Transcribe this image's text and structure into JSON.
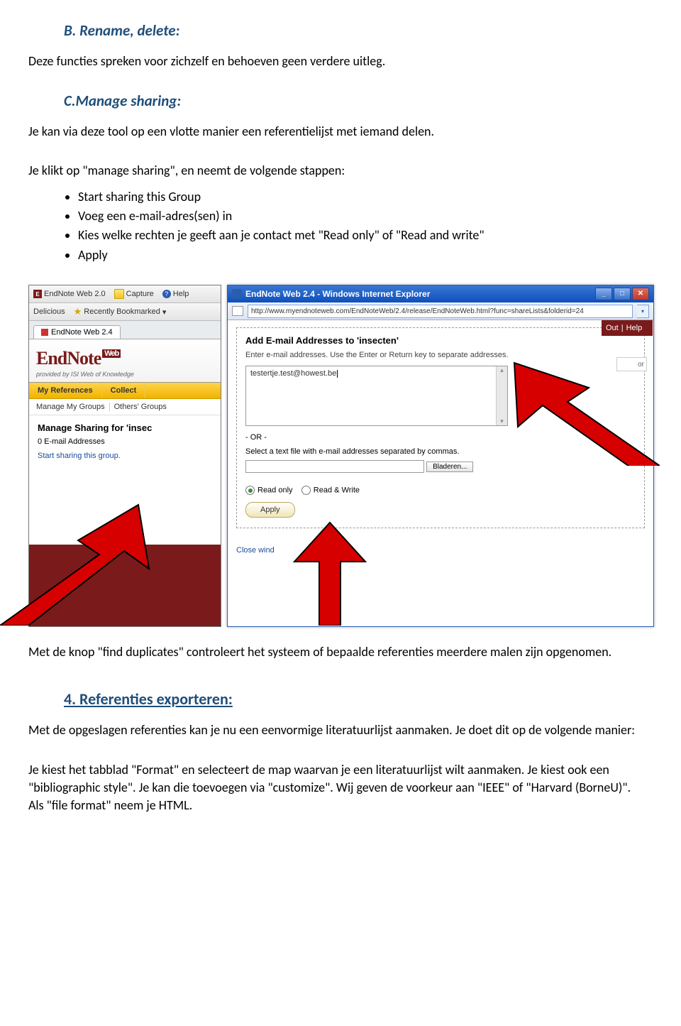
{
  "sectionB": {
    "title": "B. Rename, delete:",
    "body": "Deze functies spreken voor zichzelf en behoeven geen verdere uitleg."
  },
  "sectionC": {
    "title": "C.Manage sharing:",
    "intro": "Je kan via deze tool op een vlotte manier een referentielijst met iemand delen.",
    "intro2": "Je klikt op \"manage sharing\", en neemt de volgende stappen:",
    "bullets": [
      "Start sharing this Group",
      "Voeg een e-mail-adres(sen) in",
      "Kies welke rechten je geeft aan je contact met \"Read only\" of \"Read and write\"",
      "Apply"
    ]
  },
  "screenshot": {
    "leftWin": {
      "toolbar": {
        "appLabel": "EndNote Web 2.0",
        "capture": "Capture",
        "help": "Help",
        "delicious": "Delicious",
        "recently": "Recently Bookmarked"
      },
      "tab": "EndNote Web 2.4",
      "logo": {
        "brand": "EndNote",
        "web": "Web",
        "sub": "provided by ISI Web of Knowledge"
      },
      "nav": {
        "refs": "My References",
        "collect": "Collect"
      },
      "subnav": {
        "a": "Manage My Groups",
        "b": "Others' Groups"
      },
      "content": {
        "title": "Manage Sharing for 'insec",
        "line": "0 E-mail Addresses",
        "link": "Start sharing this group."
      }
    },
    "rightWin": {
      "title": "EndNote Web 2.4 - Windows Internet Explorer",
      "url": "http://www.myendnoteweb.com/EndNoteWeb/2.4/release/EndNoteWeb.html?func=shareLists&folderid=24",
      "box": {
        "heading": "Add E-mail Addresses to 'insecten'",
        "desc": "Enter e-mail addresses. Use the Enter or Return key to separate addresses.",
        "emailValue": "testertje.test@howest.be",
        "or": "- OR -",
        "fileLabel": "Select a text file with e-mail addresses separated by commas.",
        "browse": "Bladeren...",
        "readOnly": "Read only",
        "readWrite": "Read & Write",
        "apply": "Apply",
        "close": "Close wind"
      }
    },
    "outHelp": {
      "out": "Out",
      "help": "Help"
    },
    "orBox": "or"
  },
  "afterShot": "Met de knop \"find duplicates\" controleert het systeem of bepaalde referenties meerdere malen zijn opgenomen.",
  "section4": {
    "title": "4. Referenties exporteren:",
    "p1": "Met de opgeslagen referenties kan je nu een eenvormige literatuurlijst aanmaken. Je doet dit op de volgende manier:",
    "p2": "Je kiest het tabblad \"Format\" en selecteert de map waarvan je een literatuurlijst wilt aanmaken. Je kiest ook een \"bibliographic style\". Je kan die toevoegen via \"customize\". Wij geven de voorkeur aan \"IEEE\" of \"Harvard (BorneU)\". Als \"file format\" neem je HTML."
  }
}
